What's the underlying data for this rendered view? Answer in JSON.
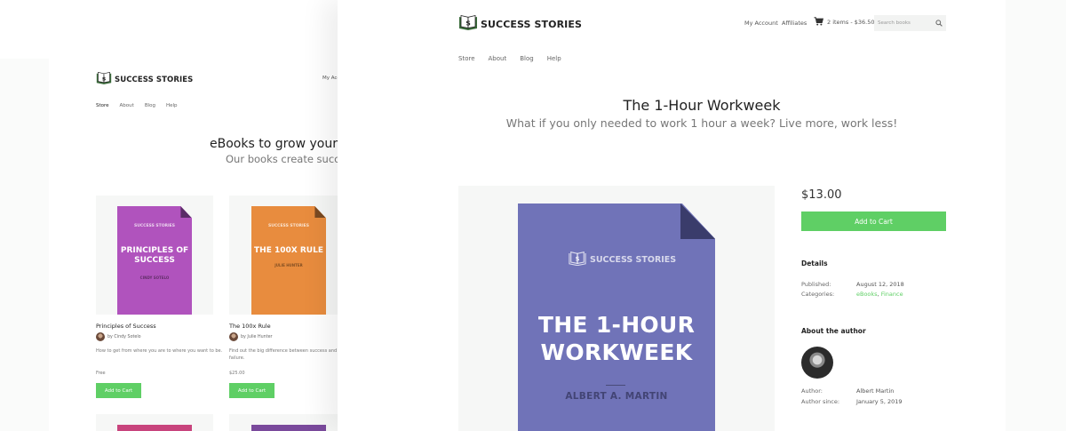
{
  "colors": {
    "accent_green": "#5fcf65",
    "cover_purple": "#7073b8",
    "cover_fold": "#3a3c6b",
    "cover_magenta": "#b053bd",
    "cover_orange": "#e88c3e"
  },
  "brand": {
    "name": "SUCCESS STORIES",
    "logo_icon": "book-dollar-icon"
  },
  "background_page": {
    "account_link": "My Acco",
    "nav": [
      "Store",
      "About",
      "Blog",
      "Help"
    ],
    "heading": "eBooks to grow your bus",
    "subheading": "Our books create success stor",
    "products": [
      {
        "cover_brand": "SUCCESS STORIES",
        "cover_title": "PRINCIPLES OF SUCCESS",
        "cover_author": "CINDY SOTELO",
        "title": "Principles of Success",
        "by": "by Cindy Sotelo",
        "description": "How to get from where you are to where you want to be.",
        "price": "Free",
        "button": "Add to Cart"
      },
      {
        "cover_brand": "SUCCESS STORIES",
        "cover_title": "THE 100X RULE",
        "cover_author": "JULIE HUNTER",
        "title": "The 100x Rule",
        "by": "by Julie Hunter",
        "description": "Find out the big difference between success and failure.",
        "price": "$25.00",
        "button": "Add to Cart"
      }
    ]
  },
  "header": {
    "my_account": "My Account",
    "affiliates": "Affiliates",
    "cart": "2 items - $36.50",
    "cart_icon": "shopping-cart-icon",
    "search_placeholder": "Search books",
    "search_icon": "search-icon",
    "nav": [
      "Store",
      "About",
      "Blog",
      "Help"
    ]
  },
  "product": {
    "title": "The 1-Hour Workweek",
    "subtitle": "What if you only needed to work 1 hour a week? Live more, work less!",
    "cover_brand": "SUCCESS STORIES",
    "cover_title": "THE 1-HOUR WORKWEEK",
    "cover_author": "ALBERT A. MARTIN",
    "price": "$13.00",
    "add_to_cart": "Add to Cart",
    "details_heading": "Details",
    "published_label": "Published:",
    "published_value": "August 12, 2018",
    "categories_label": "Categories:",
    "categories": [
      "eBooks",
      "Finance"
    ],
    "author_heading": "About the author",
    "author_label": "Author:",
    "author_value": "Albert Martin",
    "author_since_label": "Author since:",
    "author_since_value": "January 5, 2019"
  }
}
